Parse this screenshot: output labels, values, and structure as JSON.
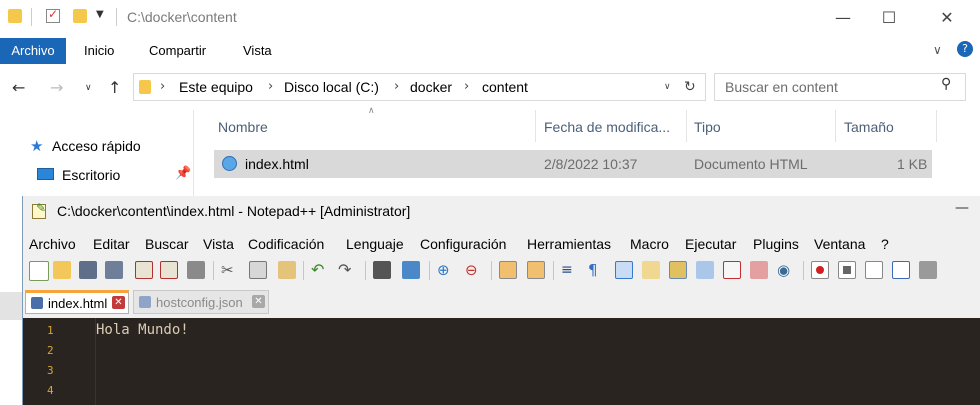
{
  "explorer": {
    "title": "C:\\docker\\content",
    "ribbon_tabs": [
      "Archivo",
      "Inicio",
      "Compartir",
      "Vista"
    ],
    "address": [
      "Este equipo",
      "Disco local (C:)",
      "docker",
      "content"
    ],
    "search_placeholder": "Buscar en content",
    "columns": [
      "Nombre",
      "Fecha de modifica...",
      "Tipo",
      "Tamaño"
    ],
    "nav": {
      "quick_access": "Acceso rápido",
      "desktop": "Escritorio"
    },
    "file": {
      "name": "index.html",
      "date": "2/8/2022 10:37",
      "type": "Documento HTML",
      "size": "1 KB"
    }
  },
  "notepad": {
    "title": "C:\\docker\\content\\index.html - Notepad++ [Administrator]",
    "menu": [
      "Archivo",
      "Editar",
      "Buscar",
      "Vista",
      "Codificación",
      "Lenguaje",
      "Configuración",
      "Herramientas",
      "Macro",
      "Ejecutar",
      "Plugins",
      "Ventana",
      "?"
    ],
    "tabs": [
      {
        "label": "index.html",
        "active": true
      },
      {
        "label": "hostconfig.json",
        "active": false
      }
    ],
    "lines": [
      "Hola Mundo!",
      "",
      "",
      ""
    ],
    "line_numbers": [
      "1",
      "2",
      "3",
      "4"
    ]
  }
}
